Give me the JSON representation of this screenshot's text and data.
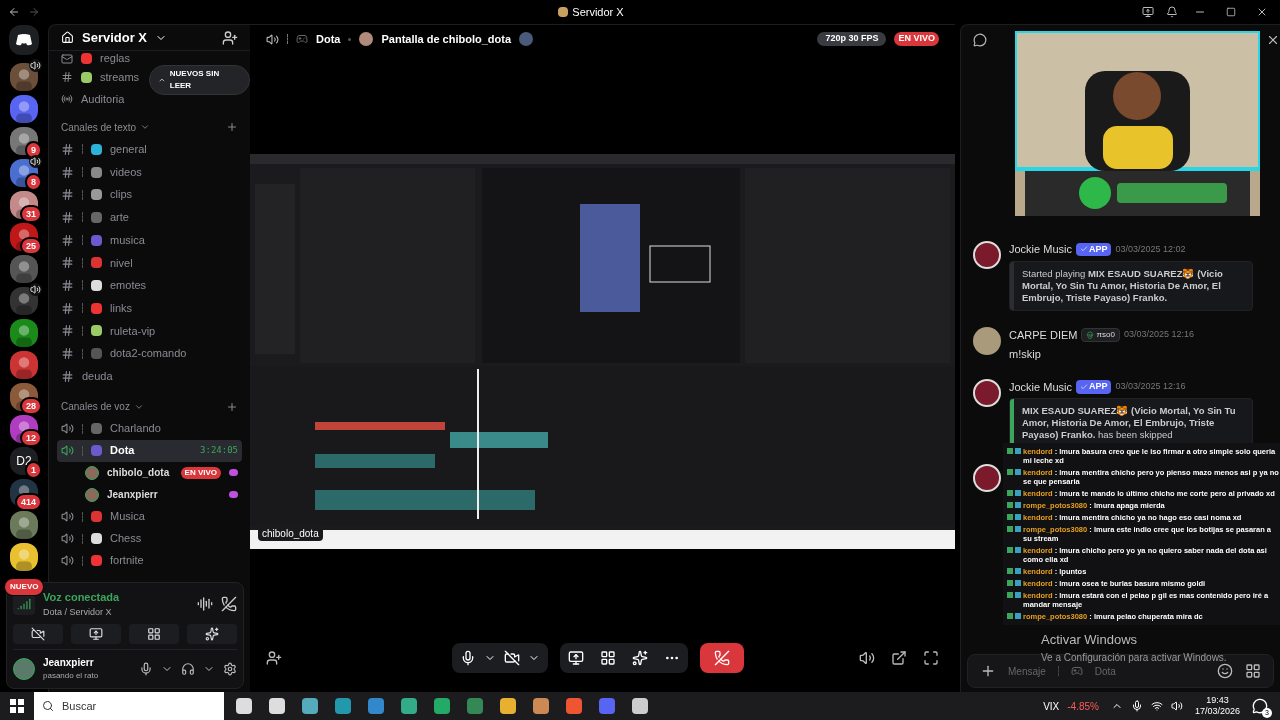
{
  "window": {
    "title": "Servidor X"
  },
  "servers": [
    {
      "kind": "avatar",
      "voice": true
    },
    {
      "kind": "avatar",
      "voice": false
    },
    {
      "kind": "avatar",
      "badge": "9",
      "voice": false
    },
    {
      "kind": "avatar",
      "badge": "8",
      "voice": true
    },
    {
      "kind": "avatar",
      "badge": "31",
      "voice": false
    },
    {
      "kind": "avatar",
      "badge": "25",
      "voice": false
    },
    {
      "kind": "avatar",
      "voice": false
    },
    {
      "kind": "avatar",
      "voice": true
    },
    {
      "kind": "avatar",
      "voice": false
    },
    {
      "kind": "avatar",
      "voice": false
    },
    {
      "kind": "avatar",
      "badge": "28",
      "voice": false
    },
    {
      "kind": "avatar",
      "badge": "12",
      "voice": false
    },
    {
      "kind": "text",
      "text": "D2",
      "badge": "1",
      "voice": false
    },
    {
      "kind": "avatar",
      "badge": "414",
      "voice": false
    },
    {
      "kind": "avatar",
      "voice": false
    },
    {
      "kind": "avatar",
      "voice": false
    }
  ],
  "new_pill": "NUEVO",
  "sidebar": {
    "server_name": "Servidor X",
    "unread_pill": "NUEVOS SIN LEER",
    "top_channels": [
      {
        "kind": "rules",
        "name": "reglas"
      },
      {
        "kind": "text",
        "name": "streams"
      },
      {
        "kind": "stage",
        "name": "Auditoria"
      }
    ],
    "text_category": {
      "title": "Canales de texto",
      "channels": [
        {
          "kind": "text",
          "name": "general"
        },
        {
          "kind": "text",
          "name": "videos"
        },
        {
          "kind": "text",
          "name": "clips"
        },
        {
          "kind": "text",
          "name": "arte"
        },
        {
          "kind": "text",
          "name": "musica"
        },
        {
          "kind": "text",
          "name": "nivel"
        },
        {
          "kind": "text",
          "name": "emotes"
        },
        {
          "kind": "text",
          "name": "links"
        },
        {
          "kind": "text",
          "name": "ruleta-vip"
        },
        {
          "kind": "text",
          "name": "dota2-comando"
        },
        {
          "kind": "plain",
          "name": "deuda"
        }
      ]
    },
    "voice_category": {
      "title": "Canales de voz",
      "channels": [
        {
          "name": "Charlando",
          "selected": false
        },
        {
          "name": "Dota",
          "selected": true,
          "timer": "3:24:05",
          "members": [
            {
              "name": "chibolo_dota",
              "live": "EN VIVO"
            },
            {
              "name": "Jeanxpierr"
            }
          ]
        },
        {
          "name": "Musica",
          "selected": false
        },
        {
          "name": "Chess",
          "selected": false
        },
        {
          "name": "fortnite",
          "selected": false
        }
      ]
    }
  },
  "voice_panel": {
    "status": "Voz conectada",
    "location": "Dota / Servidor X"
  },
  "user_panel": {
    "name": "Jeanxpierr",
    "status": "pasando el rato"
  },
  "stream": {
    "channel": "Dota",
    "title": "Pantalla de chibolo_dota",
    "quality": "720p 30 FPS",
    "live": "EN VIVO",
    "streamer_tag": "chibolo_dota"
  },
  "chat": {
    "messages": [
      {
        "kind": "embed",
        "author": "Jockie Music",
        "tag": "APP",
        "time": "03/03/2025 12:02",
        "embed": {
          "color": "#2b2d31",
          "text": "Started playing **MIX ESAUD SUAREZ🐯 (Vicio Mortal, Yo Sin Tu Amor, Historia De Amor, El Embrujo, Triste Payaso) Franko.**"
        }
      },
      {
        "kind": "text",
        "author": "CARPE DIEM",
        "tag": "πso0",
        "time": "03/03/2025 12:16",
        "text": "m!skip"
      },
      {
        "kind": "embed",
        "author": "Jockie Music",
        "tag": "APP",
        "time": "03/03/2025 12:16",
        "embed": {
          "color": "#3ba55c",
          "text": "**MIX ESAUD SUAREZ🐯 (Vicio Mortal, Yo Sin Tu Amor, Historia De Amor, El Embrujo, Triste Payaso) Franko.** has been skipped"
        }
      },
      {
        "kind": "covered"
      }
    ],
    "input_placeholder": "Mensaje",
    "input_channel": "Dota"
  },
  "chat_overlay": [
    {
      "user": "kendord",
      "text": ": lmura basura creo que le iso firmar a otro simple solo queria mi leche xd"
    },
    {
      "user": "kendord",
      "text": ": lmura mentira chicho pero yo pienso mazo menos asi p ya no se que pensaria"
    },
    {
      "user": "kendord",
      "text": ": lmura te mando lo último chicho me corte pero al privado xd"
    },
    {
      "user": "rompe_potos3080",
      "text": ": lmura apaga mierda"
    },
    {
      "user": "kendord",
      "text": ": lmura mentira chicho ya no hago eso casi noma xd"
    },
    {
      "user": "rompe_potos3080",
      "text": ": lmura este indio cree que los botijas se pasaran a su stream"
    },
    {
      "user": "kendord",
      "text": ": lmura chicho pero yo ya no quiero saber nada del dota asi como ella xd"
    },
    {
      "user": "kendord",
      "text": ": lpuntos"
    },
    {
      "user": "kendord",
      "text": ": lmura osea te burlas basura mismo goldi"
    },
    {
      "user": "kendord",
      "text": ": lmura estará con el pelao p gil es mas contenido pero iré a mandar mensaje"
    },
    {
      "user": "rompe_potos3080",
      "text": ": lmura pelao chuperata mira dc"
    }
  ],
  "activation": {
    "title": "Activar Windows",
    "text": "Ve a Configuración para activar Windows."
  },
  "taskbar": {
    "search": "Buscar",
    "stock": "VIX",
    "change": "-4.85%",
    "time": "19:43",
    "date": "17/03/2026",
    "notifications": "3"
  }
}
